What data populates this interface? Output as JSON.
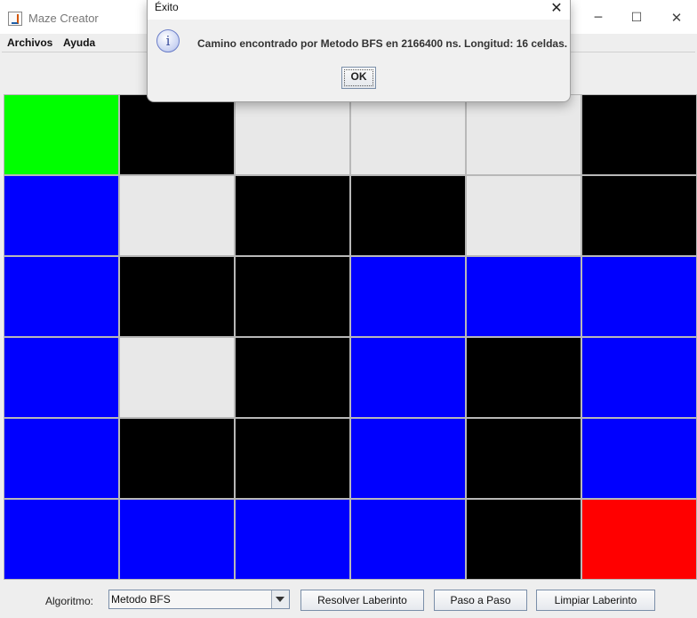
{
  "window": {
    "title": "Maze Creator",
    "controls": {
      "minimize": "─",
      "maximize": "☐",
      "close": "✕"
    }
  },
  "menu": {
    "items": [
      {
        "label": "Archivos"
      },
      {
        "label": "Ayuda"
      }
    ]
  },
  "maze": {
    "rows": 6,
    "cols": 6,
    "legend_colors": {
      "start": "#00ff00",
      "wall": "#000000",
      "empty": "#e8e8e8",
      "path": "#0000ff",
      "end": "#ff0000"
    },
    "cells": [
      [
        "start",
        "wall",
        "empty",
        "empty",
        "empty",
        "wall"
      ],
      [
        "path",
        "empty",
        "wall",
        "wall",
        "empty",
        "wall"
      ],
      [
        "path",
        "wall",
        "wall",
        "path",
        "path",
        "path"
      ],
      [
        "path",
        "empty",
        "wall",
        "path",
        "wall",
        "path"
      ],
      [
        "path",
        "wall",
        "wall",
        "path",
        "wall",
        "path"
      ],
      [
        "path",
        "path",
        "path",
        "path",
        "wall",
        "end"
      ]
    ]
  },
  "controls": {
    "algorithm_label": "Algoritmo:",
    "algorithm_selected": "Metodo BFS",
    "solve_label": "Resolver Laberinto",
    "step_label": "Paso a Paso",
    "clear_label": "Limpiar Laberinto"
  },
  "dialog": {
    "title": "Éxito",
    "icon": "info-icon",
    "message": "Camino encontrado por Metodo BFS en 2166400 ns. Longitud: 16 celdas.",
    "ok_label": "OK",
    "close_glyph": "✕"
  }
}
